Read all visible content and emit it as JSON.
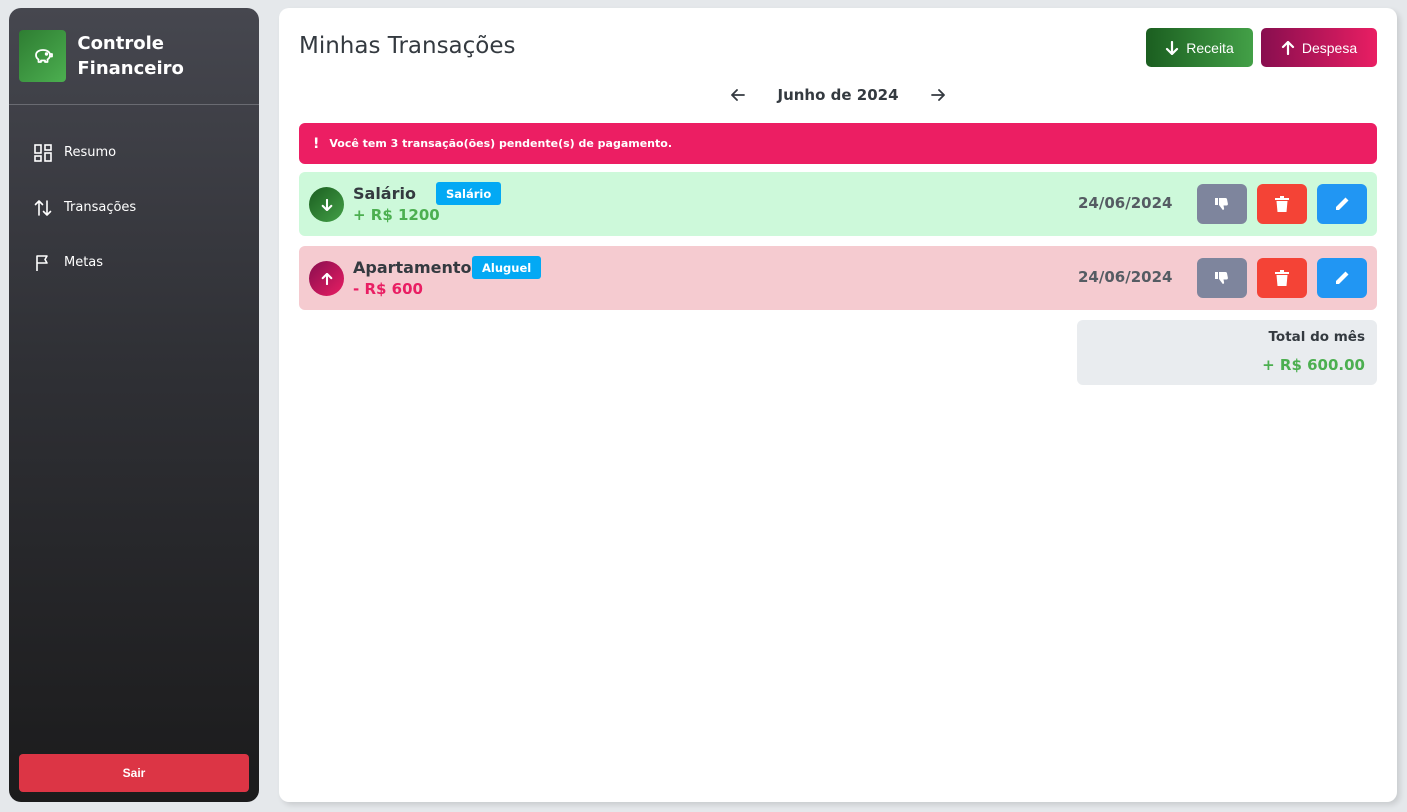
{
  "sidebar": {
    "brand_title": "Controle Financeiro",
    "brand_icon": "piggy-bank-icon",
    "items": [
      {
        "label": "Resumo",
        "icon": "dashboard-icon"
      },
      {
        "label": "Transações",
        "icon": "swap-vertical-icon"
      },
      {
        "label": "Metas",
        "icon": "flag-icon"
      }
    ],
    "logout_label": "Sair"
  },
  "header": {
    "title": "Minhas Transações",
    "receita_label": "Receita",
    "despesa_label": "Despesa"
  },
  "month": {
    "label": "Junho de 2024"
  },
  "alert": {
    "text": "Você tem 3 transação(ões) pendente(s) de pagamento."
  },
  "transactions": [
    {
      "type": "income",
      "name": "Salário",
      "category": "Salário",
      "amount": "+ R$ 1200",
      "date": "24/06/2024"
    },
    {
      "type": "expense",
      "name": "Apartamento",
      "category": "Aluguel",
      "amount": "- R$ 600",
      "date": "24/06/2024"
    }
  ],
  "total": {
    "label": "Total do mês",
    "value": "+ R$ 600.00"
  },
  "colors": {
    "income": "#4caf50",
    "expense": "#e91e63",
    "alert": "#ec1e63",
    "badge": "#03a9f4",
    "logout": "#dc3545"
  }
}
